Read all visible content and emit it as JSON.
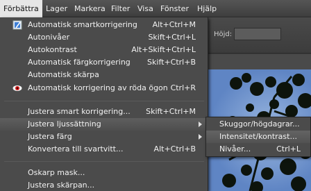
{
  "menubar": {
    "items": [
      "Förbättra",
      "Lager",
      "Markera",
      "Filter",
      "Visa",
      "Fönster",
      "Hjälp"
    ]
  },
  "toolbar": {
    "height_label": "Höjd:"
  },
  "menu": {
    "groups": [
      [
        {
          "label": "Automatisk smartkorrigering",
          "shortcut": "Alt+Ctrl+M",
          "icon": "smart-fix-icon"
        },
        {
          "label": "Autonivåer",
          "shortcut": "Skift+Ctrl+L"
        },
        {
          "label": "Autokontrast",
          "shortcut": "Alt+Skift+Ctrl+L"
        },
        {
          "label": "Automatisk färgkorrigering",
          "shortcut": "Skift+Ctrl+B"
        },
        {
          "label": "Automatisk skärpa",
          "shortcut": ""
        },
        {
          "label": "Automatisk korrigering av röda ögon",
          "shortcut": "Ctrl+R",
          "icon": "red-eye-icon"
        }
      ],
      [
        {
          "label": "Justera smart korrigering...",
          "shortcut": "Skift+Ctrl+M"
        },
        {
          "label": "Justera ljussättning",
          "shortcut": "",
          "submenu": true,
          "highlighted": true
        },
        {
          "label": "Justera färg",
          "shortcut": "",
          "submenu": true
        },
        {
          "label": "Konvertera till svartvitt...",
          "shortcut": "Alt+Ctrl+B"
        }
      ],
      [
        {
          "label": "Oskarp mask...",
          "shortcut": ""
        },
        {
          "label": "Justera skärpan...",
          "shortcut": ""
        }
      ]
    ]
  },
  "submenu": {
    "items": [
      {
        "label": "Skuggor/högdagrar...",
        "shortcut": ""
      },
      {
        "label": "Intensitet/kontrast...",
        "shortcut": "",
        "highlighted": true
      },
      {
        "label": "Nivåer...",
        "shortcut": "Ctrl+L"
      }
    ]
  }
}
